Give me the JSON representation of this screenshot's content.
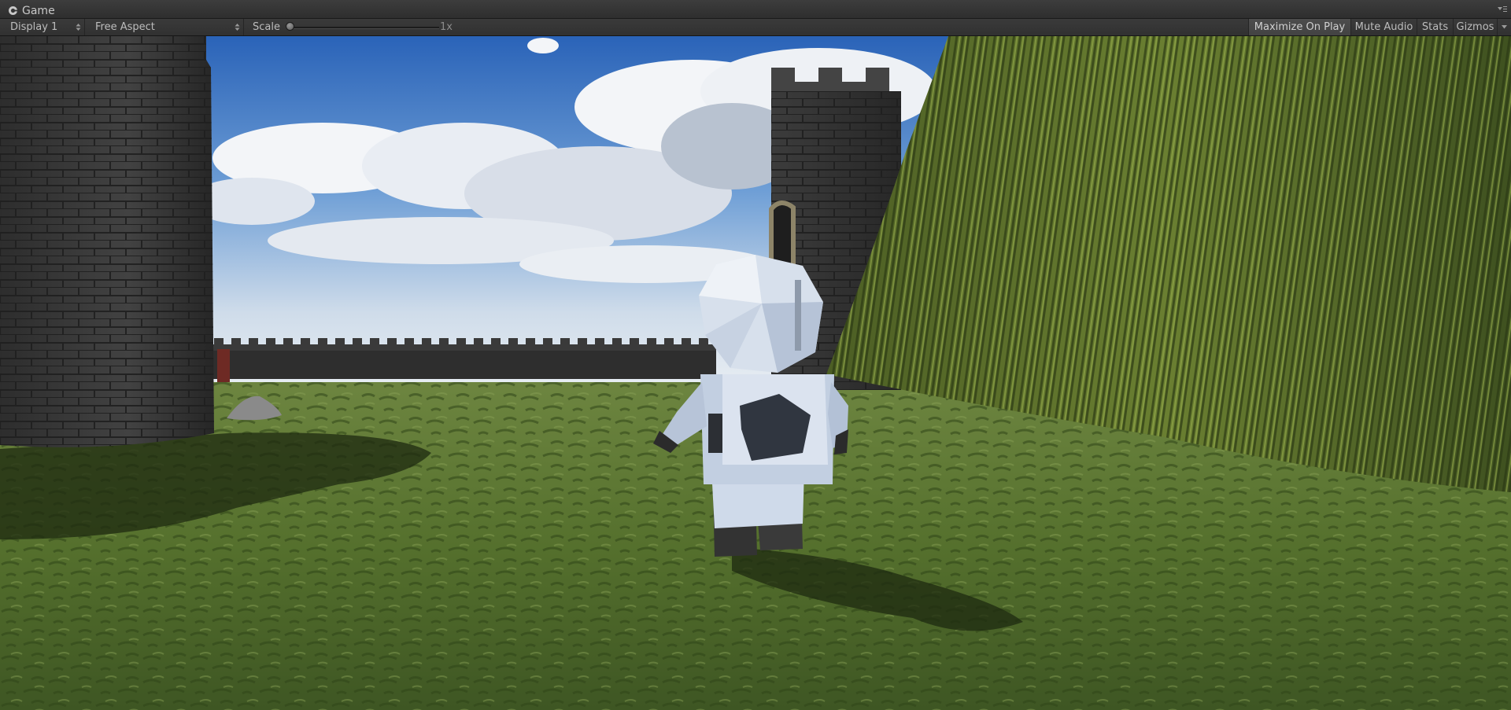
{
  "window": {
    "tab_title": "Game"
  },
  "toolbar": {
    "display_label": "Display 1",
    "aspect_label": "Free Aspect",
    "scale_label": "Scale",
    "scale_value": "1x",
    "scale_fraction": 0.0,
    "maximize_label": "Maximize On Play",
    "maximize_active": true,
    "mute_label": "Mute Audio",
    "stats_label": "Stats",
    "gizmos_label": "Gizmos"
  },
  "scene": {
    "objects": [
      "left-stone-tower",
      "right-stone-tower",
      "castle-wall",
      "grassy-cliff",
      "grass-ground",
      "low-poly-astronaut-character",
      "rock-pile",
      "red-banner"
    ],
    "colors": {
      "sky_top": "#2a63b8",
      "sky_horizon": "#dfe8f2",
      "grass": "#5c7233",
      "stone": "#3b3b3b",
      "character": "#c9d6e8"
    }
  }
}
